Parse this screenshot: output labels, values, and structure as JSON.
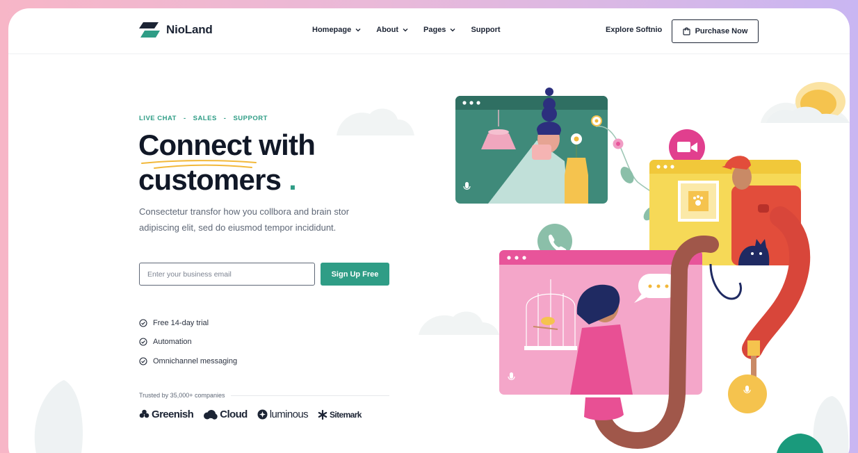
{
  "brand": {
    "name": "NioLand"
  },
  "nav": {
    "items": [
      {
        "label": "Homepage",
        "has_dropdown": true
      },
      {
        "label": "About",
        "has_dropdown": true
      },
      {
        "label": "Pages",
        "has_dropdown": true
      },
      {
        "label": "Support",
        "has_dropdown": false
      }
    ],
    "explore_label": "Explore Softnio",
    "purchase_label": "Purchase Now",
    "purchase_icon": "shopping-bag-icon"
  },
  "hero": {
    "eyebrow": [
      "LIVE CHAT",
      "-",
      "SALES",
      "-",
      "SUPPORT"
    ],
    "headline_word1": "Connect",
    "headline_word2": "with",
    "headline_line2": "customers",
    "headline_dot": ".",
    "description": "Consectetur  transfor how you collbora and brain stor adipiscing elit, sed do eiusmod tempor incididunt.",
    "email_placeholder": "Enter your business email",
    "signup_label": "Sign Up Free",
    "features": [
      "Free 14-day trial",
      "Automation",
      "Omnichannel messaging"
    ],
    "trusted_text": "Trusted by 35,000+ companies",
    "logos": [
      "Greenish",
      "Cloud",
      "luminous",
      "Sitemark"
    ]
  },
  "colors": {
    "accent": "#2f9d86",
    "text_dark": "#111827",
    "teal_window": "#3f8a7a",
    "yellow_window": "#f6d957",
    "pink_window": "#f4a6c9",
    "pink_header": "#e8549a",
    "highlight": "#f2b83a"
  }
}
